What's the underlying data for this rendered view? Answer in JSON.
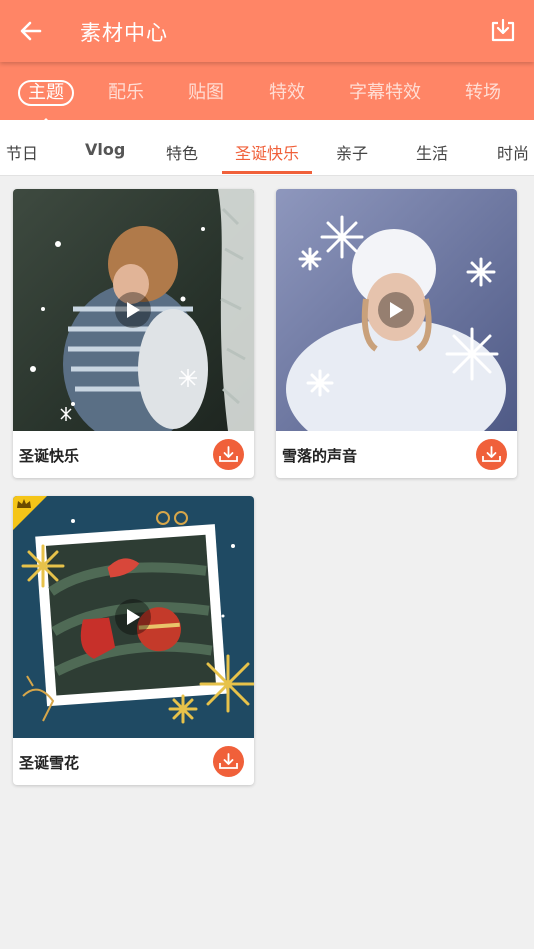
{
  "header": {
    "title": "素材中心",
    "back_icon": "arrow-left-icon",
    "download_icon": "download-tray-icon"
  },
  "category_tabs": [
    {
      "label": "主题",
      "active": true
    },
    {
      "label": "配乐",
      "active": false
    },
    {
      "label": "贴图",
      "active": false
    },
    {
      "label": "特效",
      "active": false
    },
    {
      "label": "字幕特效",
      "active": false
    },
    {
      "label": "转场",
      "active": false
    }
  ],
  "sub_tabs": [
    {
      "label": "节日",
      "active": false
    },
    {
      "label": "Vlog",
      "active": false
    },
    {
      "label": "特色",
      "active": false
    },
    {
      "label": "圣诞快乐",
      "active": true
    },
    {
      "label": "亲子",
      "active": false
    },
    {
      "label": "生活",
      "active": false
    },
    {
      "label": "时尚",
      "active": false
    }
  ],
  "cards": [
    {
      "title": "圣诞快乐",
      "premium": false,
      "thumbnail": "couple-hugging-in-snow",
      "play_icon": "play-icon",
      "download_icon": "download-icon"
    },
    {
      "title": "雪落的声音",
      "premium": false,
      "thumbnail": "woman-in-white-hat-snowflakes",
      "play_icon": "play-icon",
      "download_icon": "download-icon"
    },
    {
      "title": "圣诞雪花",
      "premium": true,
      "premium_icon": "crown-icon",
      "thumbnail": "christmas-ornaments-frame",
      "play_icon": "play-icon",
      "download_icon": "download-icon"
    }
  ],
  "colors": {
    "header": "#ff8566",
    "accent": "#f0603a",
    "background": "#f0f0f0",
    "premium": "#f5c518"
  }
}
